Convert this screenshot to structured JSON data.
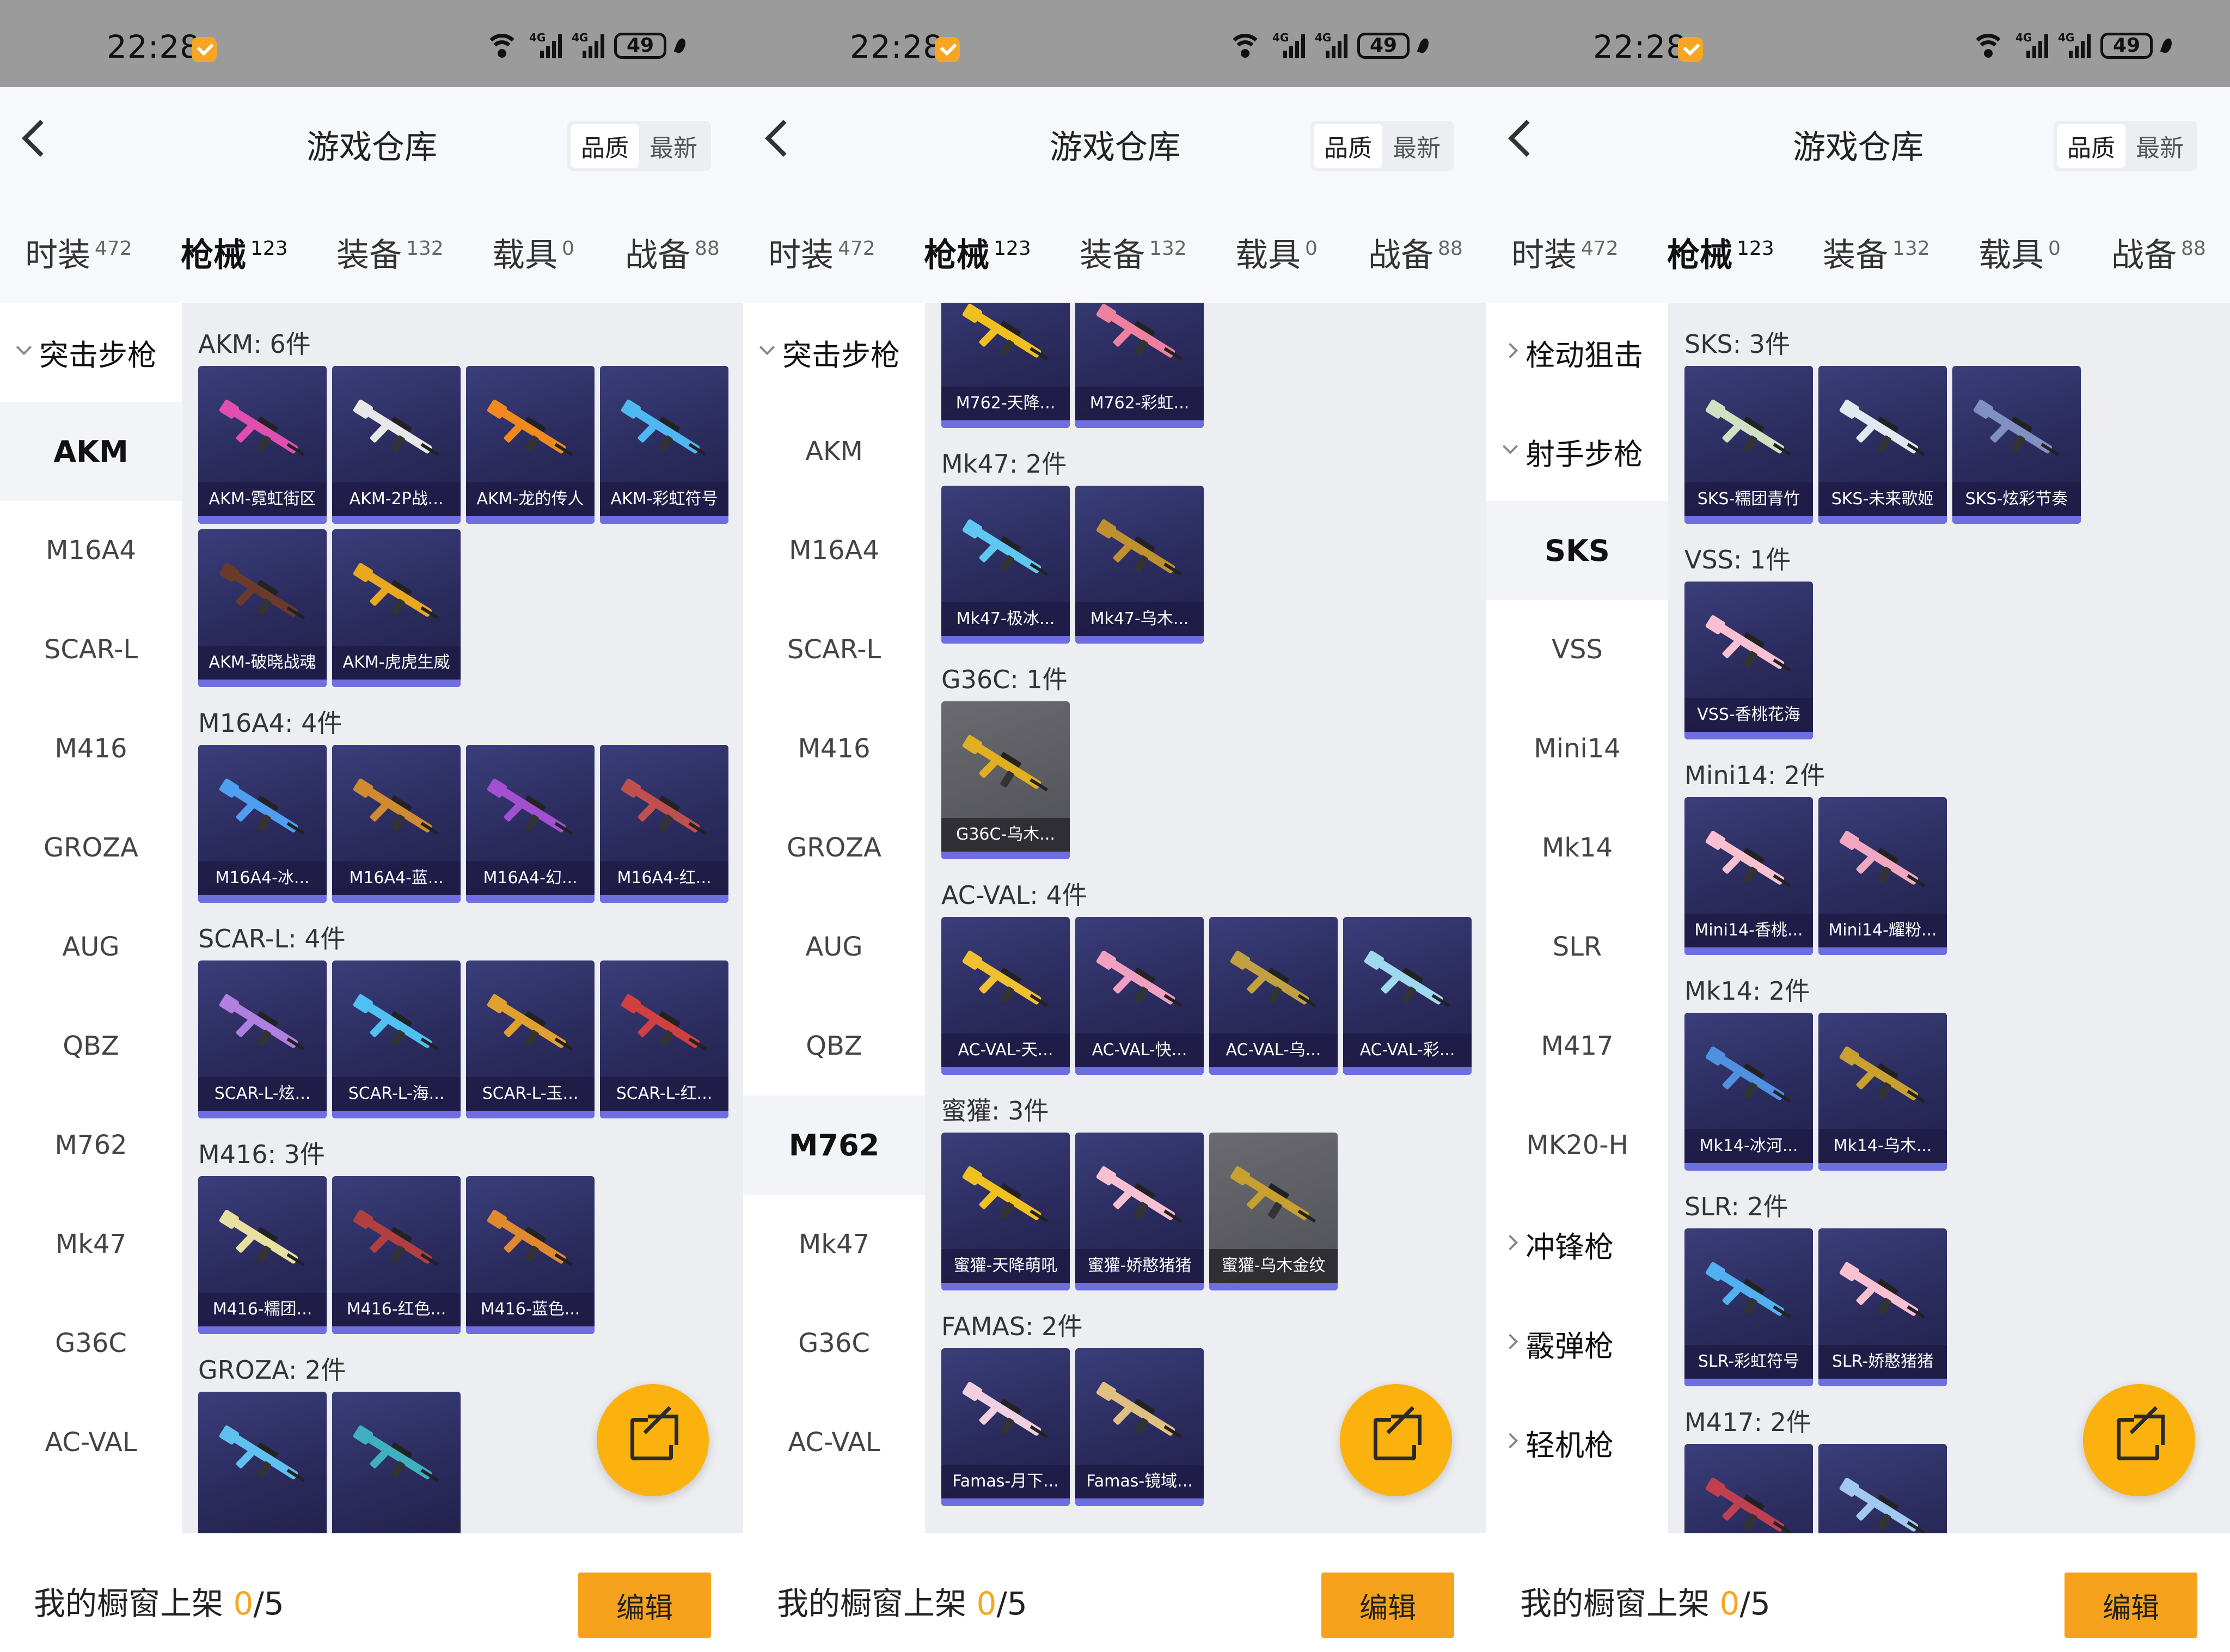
{
  "status": {
    "time": "22:28",
    "battery": "49",
    "net1": "4G",
    "net2": "4G"
  },
  "header": {
    "title": "游戏仓库",
    "sort_quality": "品质",
    "sort_latest": "最新"
  },
  "tabs": [
    {
      "label": "时装",
      "count": "472"
    },
    {
      "label": "枪械",
      "count": "123"
    },
    {
      "label": "装备",
      "count": "132"
    },
    {
      "label": "载具",
      "count": "0"
    },
    {
      "label": "战备",
      "count": "88"
    }
  ],
  "footer": {
    "label": "我的橱窗上架 ",
    "current": "0",
    "total": "/5",
    "edit": "编辑"
  },
  "panels": [
    {
      "sidebar": [
        {
          "label": "突击步枪",
          "type": "group-open"
        },
        {
          "label": "AKM",
          "type": "active"
        },
        {
          "label": "M16A4"
        },
        {
          "label": "SCAR-L"
        },
        {
          "label": "M416"
        },
        {
          "label": "GROZA"
        },
        {
          "label": "AUG"
        },
        {
          "label": "QBZ"
        },
        {
          "label": "M762"
        },
        {
          "label": "Mk47"
        },
        {
          "label": "G36C"
        },
        {
          "label": "AC-VAL"
        }
      ],
      "sections": [
        {
          "title": "AKM: 6件",
          "items": [
            {
              "label": "AKM-霓虹街区",
              "color": "#e04fb0"
            },
            {
              "label": "AKM-2P战...",
              "color": "#e8e8e8"
            },
            {
              "label": "AKM-龙的传人",
              "color": "#f08a20"
            },
            {
              "label": "AKM-彩虹符号",
              "color": "#4fb8f0"
            },
            {
              "label": "AKM-破晓战魂",
              "color": "#6a3a2a"
            },
            {
              "label": "AKM-虎虎生威",
              "color": "#e8a820"
            }
          ]
        },
        {
          "title": "M16A4: 4件",
          "items": [
            {
              "label": "M16A4-冰...",
              "color": "#4f9ef0"
            },
            {
              "label": "M16A4-蓝...",
              "color": "#d08a30"
            },
            {
              "label": "M16A4-幻...",
              "color": "#a050d0"
            },
            {
              "label": "M16A4-红...",
              "color": "#c05050"
            }
          ]
        },
        {
          "title": "SCAR-L: 4件",
          "items": [
            {
              "label": "SCAR-L-炫...",
              "color": "#b080e0"
            },
            {
              "label": "SCAR-L-海...",
              "color": "#50c0f0"
            },
            {
              "label": "SCAR-L-玉...",
              "color": "#e0a030"
            },
            {
              "label": "SCAR-L-红...",
              "color": "#d04040"
            }
          ]
        },
        {
          "title": "M416: 3件",
          "items": [
            {
              "label": "M416-糯团...",
              "color": "#e8e0a0"
            },
            {
              "label": "M416-红色...",
              "color": "#b04040"
            },
            {
              "label": "M416-蓝色...",
              "color": "#e08a30"
            }
          ]
        },
        {
          "title": "GROZA: 2件",
          "items": [
            {
              "label": "",
              "color": "#60c0f0"
            },
            {
              "label": "",
              "color": "#40b0c0"
            }
          ]
        }
      ]
    },
    {
      "sidebar": [
        {
          "label": "突击步枪",
          "type": "group-open"
        },
        {
          "label": "AKM"
        },
        {
          "label": "M16A4"
        },
        {
          "label": "SCAR-L"
        },
        {
          "label": "M416"
        },
        {
          "label": "GROZA"
        },
        {
          "label": "AUG"
        },
        {
          "label": "QBZ"
        },
        {
          "label": "M762",
          "type": "active"
        },
        {
          "label": "Mk47"
        },
        {
          "label": "G36C"
        },
        {
          "label": "AC-VAL"
        }
      ],
      "sections": [
        {
          "title": "",
          "items": [
            {
              "label": "M762-天降...",
              "color": "#f0c020"
            },
            {
              "label": "M762-彩虹...",
              "color": "#f080a0"
            }
          ]
        },
        {
          "title": "Mk47: 2件",
          "items": [
            {
              "label": "Mk47-极冰...",
              "color": "#60c8f0"
            },
            {
              "label": "Mk47-乌木...",
              "color": "#c09030"
            }
          ]
        },
        {
          "title": "G36C: 1件",
          "items": [
            {
              "label": "G36C-乌木...",
              "color": "#e0b020",
              "gray": true
            }
          ]
        },
        {
          "title": "AC-VAL: 4件",
          "items": [
            {
              "label": "AC-VAL-天...",
              "color": "#f0c030"
            },
            {
              "label": "AC-VAL-快...",
              "color": "#f0a0c0"
            },
            {
              "label": "AC-VAL-乌...",
              "color": "#c0a040"
            },
            {
              "label": "AC-VAL-彩...",
              "color": "#a0d8f0"
            }
          ]
        },
        {
          "title": "蜜獾: 3件",
          "items": [
            {
              "label": "蜜獾-天降萌吼",
              "color": "#f0c020"
            },
            {
              "label": "蜜獾-娇憨猪猪",
              "color": "#f8c0d0"
            },
            {
              "label": "蜜獾-乌木金纹",
              "color": "#c8a030",
              "gray": true
            }
          ]
        },
        {
          "title": "FAMAS: 2件",
          "items": [
            {
              "label": "Famas-月下...",
              "color": "#f0d0e0"
            },
            {
              "label": "Famas-镜域...",
              "color": "#e0c080"
            }
          ]
        }
      ]
    },
    {
      "sidebar": [
        {
          "label": "栓动狙击",
          "type": "group-closed"
        },
        {
          "label": "射手步枪",
          "type": "group-open"
        },
        {
          "label": "SKS",
          "type": "active"
        },
        {
          "label": "VSS"
        },
        {
          "label": "Mini14"
        },
        {
          "label": "Mk14"
        },
        {
          "label": "SLR"
        },
        {
          "label": "M417"
        },
        {
          "label": "MK20-H"
        },
        {
          "label": "冲锋枪",
          "type": "group-closed"
        },
        {
          "label": "霰弹枪",
          "type": "group-closed"
        },
        {
          "label": "轻机枪",
          "type": "group-closed"
        }
      ],
      "sections": [
        {
          "title": "SKS: 3件",
          "items": [
            {
              "label": "SKS-糯团青竹",
              "color": "#d0e0c0"
            },
            {
              "label": "SKS-未来歌姬",
              "color": "#e0e8f0"
            },
            {
              "label": "SKS-炫彩节奏",
              "color": "#8090c0"
            }
          ]
        },
        {
          "title": "VSS: 1件",
          "items": [
            {
              "label": "VSS-香桃花海",
              "color": "#f8c0d0"
            }
          ]
        },
        {
          "title": "Mini14: 2件",
          "items": [
            {
              "label": "Mini14-香桃...",
              "color": "#f8c0d0"
            },
            {
              "label": "Mini14-耀粉...",
              "color": "#f0a8c0"
            }
          ]
        },
        {
          "title": "Mk14: 2件",
          "items": [
            {
              "label": "Mk14-冰河...",
              "color": "#5090e0"
            },
            {
              "label": "Mk14-乌木...",
              "color": "#c8a030"
            }
          ]
        },
        {
          "title": "SLR: 2件",
          "items": [
            {
              "label": "SLR-彩虹符号",
              "color": "#50b0f0"
            },
            {
              "label": "SLR-娇憨猪猪",
              "color": "#f8c0d0"
            }
          ]
        },
        {
          "title": "M417: 2件",
          "items": [
            {
              "label": "",
              "color": "#c04050"
            },
            {
              "label": "",
              "color": "#a0c8f0"
            }
          ]
        }
      ]
    }
  ]
}
